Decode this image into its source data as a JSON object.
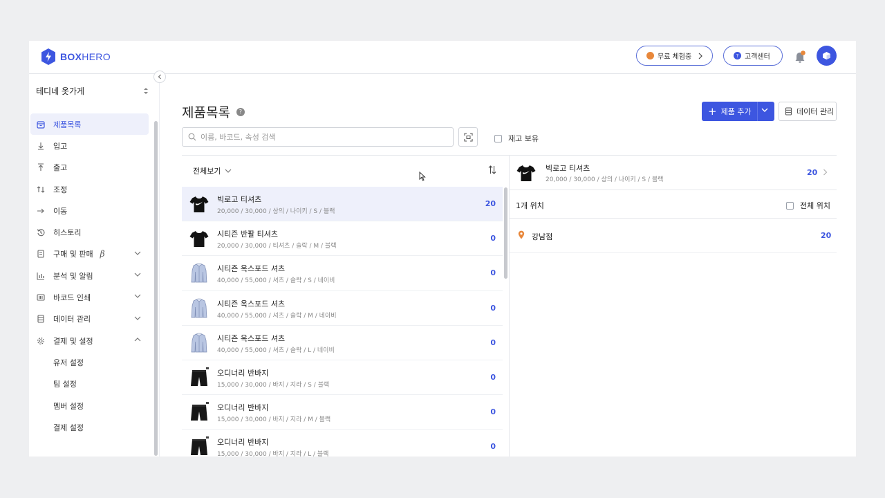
{
  "brand": {
    "name_bold": "BOX",
    "name_rest": "HERO",
    "accent": "#3d56e0"
  },
  "header": {
    "trial_label": "무료 체험중",
    "help_label": "고객센터"
  },
  "sidebar": {
    "store_name": "테디네 옷가게",
    "items": [
      {
        "label": "제품목록",
        "icon": "box-icon",
        "active": true
      },
      {
        "label": "입고",
        "icon": "arrow-down-icon"
      },
      {
        "label": "출고",
        "icon": "arrow-up-icon"
      },
      {
        "label": "조정",
        "icon": "adjust-icon"
      },
      {
        "label": "이동",
        "icon": "arrow-right-icon"
      },
      {
        "label": "히스토리",
        "icon": "history-icon"
      },
      {
        "label": "구매 및 판매",
        "icon": "document-icon",
        "badge": "β"
      },
      {
        "label": "분석 및 알림",
        "icon": "chart-icon"
      },
      {
        "label": "바코드 인쇄",
        "icon": "barcode-icon"
      },
      {
        "label": "데이터 관리",
        "icon": "database-icon"
      },
      {
        "label": "결제 및 설정",
        "icon": "gear-icon"
      }
    ],
    "sub_items": [
      "유저 설정",
      "팀 설정",
      "멤버 설정",
      "결제 설정"
    ]
  },
  "main": {
    "title": "제품목록",
    "add_button": "제품 추가",
    "data_button": "데이터 관리",
    "search_placeholder": "이름, 바코드, 속성 검색",
    "stock_filter": "재고 보유",
    "view_filter": "전체보기"
  },
  "products": [
    {
      "name": "빅로고 티셔츠",
      "meta": "20,000 / 30,000 / 상의 / 나이키 / S / 블랙",
      "qty": "20",
      "thumb": "tshirt-logo"
    },
    {
      "name": "시티즌 반팔 티셔츠",
      "meta": "20,000 / 30,000 / 티셔츠 / 슬락 / M / 블랙",
      "qty": "0",
      "thumb": "tshirt"
    },
    {
      "name": "시티즌 옥스포드 셔츠",
      "meta": "40,000 / 55,000 / 셔츠 / 슬락 / S / 네이비",
      "qty": "0",
      "thumb": "shirt"
    },
    {
      "name": "시티즌 옥스포드 셔츠",
      "meta": "40,000 / 55,000 / 셔츠 / 슬락 / M / 네이비",
      "qty": "0",
      "thumb": "shirt"
    },
    {
      "name": "시티즌 옥스포드 셔츠",
      "meta": "40,000 / 55,000 / 셔츠 / 슬락 / L / 네이비",
      "qty": "0",
      "thumb": "shirt"
    },
    {
      "name": "오디너리 반바지",
      "meta": "15,000 / 30,000 / 바지 / 지라 / S / 블랙",
      "qty": "0",
      "thumb": "shorts"
    },
    {
      "name": "오디너리 반바지",
      "meta": "15,000 / 30,000 / 바지 / 지라 / M / 블랙",
      "qty": "0",
      "thumb": "shorts"
    },
    {
      "name": "오디너리 반바지",
      "meta": "15,000 / 30,000 / 바지 / 지라 / L / 블랙",
      "qty": "0",
      "thumb": "shorts"
    }
  ],
  "detail": {
    "product_name": "빅로고 티셔츠",
    "product_meta": "20,000 / 30,000 / 상의 / 나이키 / S / 블랙",
    "product_qty": "20",
    "location_count": "1개 위치",
    "all_locations": "전체 위치",
    "locations": [
      {
        "name": "강남점",
        "qty": "20"
      }
    ]
  }
}
